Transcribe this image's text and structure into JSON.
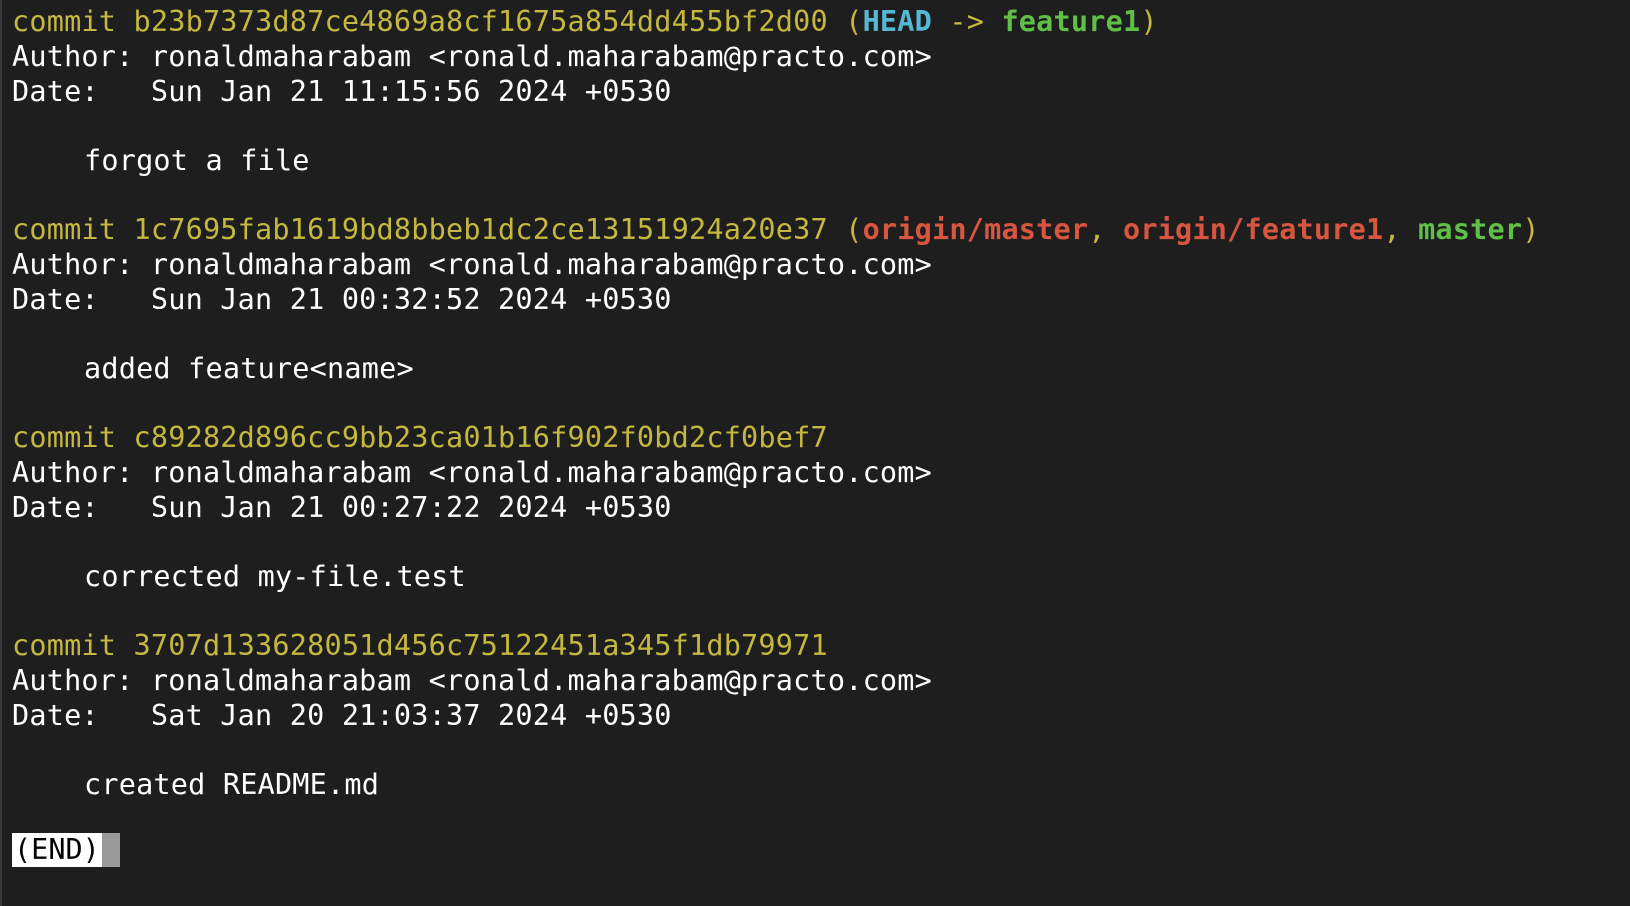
{
  "window": {
    "background": "#1e1e1e"
  },
  "colors": {
    "commit_yellow": "#c5b83f",
    "head_cyan": "#55b9d6",
    "branch_green": "#5fbf46",
    "remote_red": "#d8563f",
    "text_white": "#ffffff"
  },
  "commits": [
    {
      "commit_word": "commit",
      "hash": "b23b7373d87ce4869a8cf1675a854dd455bf2d00",
      "ref_open": "(",
      "head": "HEAD",
      "arrow": " -> ",
      "branch_local": "feature1",
      "ref_close": ")",
      "author_label": "Author:",
      "author": "ronaldmaharabam <ronald.maharabam@practo.com>",
      "date_label": "Date:",
      "date": "Sun Jan 21 11:15:56 2024 +0530",
      "message": "forgot a file"
    },
    {
      "commit_word": "commit",
      "hash": "1c7695fab1619bd8bbeb1dc2ce13151924a20e37",
      "ref_open": "(",
      "remote1": "origin/master",
      "sep1": ", ",
      "remote2": "origin/feature1",
      "sep2": ", ",
      "branch_local": "master",
      "ref_close": ")",
      "author_label": "Author:",
      "author": "ronaldmaharabam <ronald.maharabam@practo.com>",
      "date_label": "Date:",
      "date": "Sun Jan 21 00:32:52 2024 +0530",
      "message": "added feature<name>"
    },
    {
      "commit_word": "commit",
      "hash": "c89282d896cc9bb23ca01b16f902f0bd2cf0bef7",
      "author_label": "Author:",
      "author": "ronaldmaharabam <ronald.maharabam@practo.com>",
      "date_label": "Date:",
      "date": "Sun Jan 21 00:27:22 2024 +0530",
      "message": "corrected my-file.test"
    },
    {
      "commit_word": "commit",
      "hash": "3707d133628051d456c75122451a345f1db79971",
      "author_label": "Author:",
      "author": "ronaldmaharabam <ronald.maharabam@practo.com>",
      "date_label": "Date:",
      "date": "Sat Jan 20 21:03:37 2024 +0530",
      "message": "created README.md"
    }
  ],
  "pager": {
    "end_label": "(END)"
  }
}
